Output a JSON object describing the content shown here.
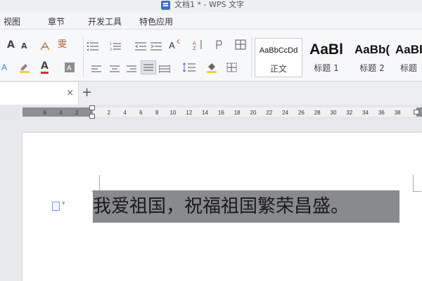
{
  "window": {
    "title": "文档1 * - WPS 文字",
    "icon": "wps-doc-icon"
  },
  "menubar": {
    "items": [
      "视图",
      "章节",
      "开发工具",
      "特色应用"
    ]
  },
  "ribbon": {
    "font_size_grow": "A",
    "font_size_shrink": "A",
    "phonetic": "雯",
    "font_color": "A",
    "style_gallery": [
      {
        "sample": "AaBbCcDd",
        "name": "正文"
      },
      {
        "sample": "AaBl",
        "name": "标题 1"
      },
      {
        "sample": "AaBb(",
        "name": "标题 2"
      },
      {
        "sample": "AaBb",
        "name": "标题"
      }
    ]
  },
  "tabs": {
    "close_glyph": "×",
    "new_tab_glyph": "+"
  },
  "ruler": {
    "left_labels": [
      "6",
      "4",
      "2"
    ],
    "right_labels": [
      "2",
      "4",
      "6",
      "8",
      "10",
      "12",
      "14",
      "16",
      "18",
      "20",
      "22",
      "24",
      "26",
      "28",
      "30",
      "32",
      "34",
      "36",
      "38"
    ]
  },
  "document": {
    "text": "我爱祖国，祝福祖国繁荣昌盛。",
    "selected": true
  },
  "colors": {
    "selection": "#888a8d",
    "accent": "#3a72c8"
  }
}
